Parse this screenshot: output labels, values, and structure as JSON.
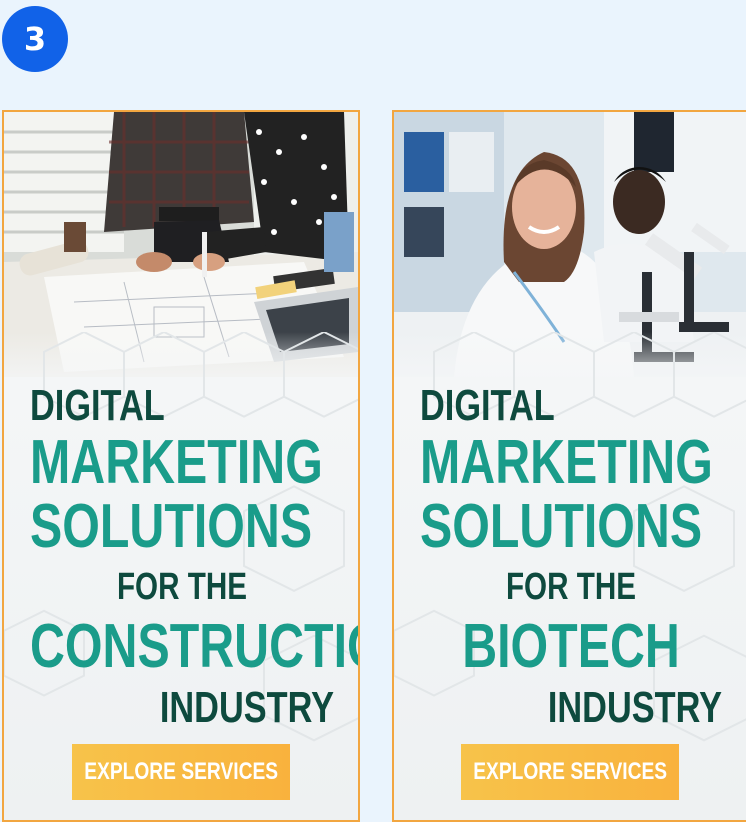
{
  "step": {
    "number": "3"
  },
  "banners": [
    {
      "photo_subject": "people reviewing architectural blueprints on a desk",
      "headline": {
        "line1": "DIGITAL",
        "line2": "MARKETING",
        "line3": "SOLUTIONS",
        "line4": "FOR THE",
        "line5": "CONSTRUCTION",
        "line6": "INDUSTRY"
      },
      "cta_label": "EXPLORE SERVICES"
    },
    {
      "photo_subject": "scientists working with microscopes in a laboratory",
      "headline": {
        "line1": "DIGITAL",
        "line2": "MARKETING",
        "line3": "SOLUTIONS",
        "line4": "FOR THE",
        "line5": "BIOTECH",
        "line6": "INDUSTRY"
      },
      "cta_label": "EXPLORE SERVICES"
    }
  ],
  "colors": {
    "page_background": "#eaf4fd",
    "badge": "#1162e8",
    "banner_border": "#f2a640",
    "headline_dark": "#0e4a3e",
    "headline_teal": "#1a9c8a",
    "cta": "#f9b23d"
  }
}
